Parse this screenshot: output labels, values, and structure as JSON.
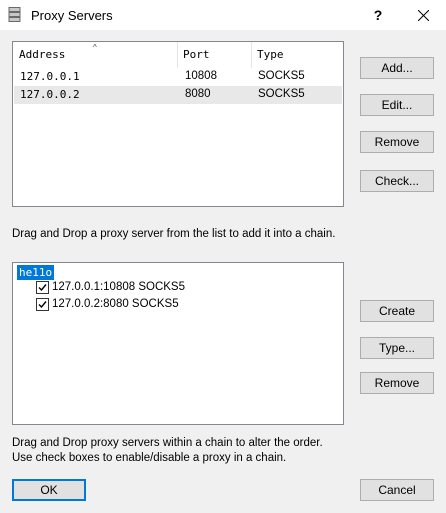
{
  "window": {
    "title": "Proxy Servers",
    "help_label": "?",
    "icon": "server-icon"
  },
  "proxy_list": {
    "columns": [
      "Address",
      "Port",
      "Type"
    ],
    "rows": [
      {
        "address": "127.0.0.1",
        "port": "10808",
        "type": "SOCKS5",
        "selected": false
      },
      {
        "address": "127.0.0.2",
        "port": "8080",
        "type": "SOCKS5",
        "selected": true
      }
    ]
  },
  "list_buttons": {
    "add": "Add...",
    "edit": "Edit...",
    "remove": "Remove",
    "check": "Check..."
  },
  "hint_top": "Drag and Drop a proxy server from the list to add it into a chain.",
  "chain_tree": {
    "root": "he11o",
    "items": [
      {
        "label": "127.0.0.1:10808 SOCKS5",
        "checked": true
      },
      {
        "label": "127.0.0.2:8080 SOCKS5",
        "checked": true
      }
    ]
  },
  "chain_buttons": {
    "create": "Create",
    "type": "Type...",
    "remove": "Remove"
  },
  "hint_bottom_1": "Drag and Drop proxy servers within a chain to alter the order.",
  "hint_bottom_2": "Use check boxes to enable/disable a proxy in a chain.",
  "footer": {
    "ok": "OK",
    "cancel": "Cancel"
  },
  "colors": {
    "accent": "#0078d7",
    "selection": "#e8e8e8"
  }
}
